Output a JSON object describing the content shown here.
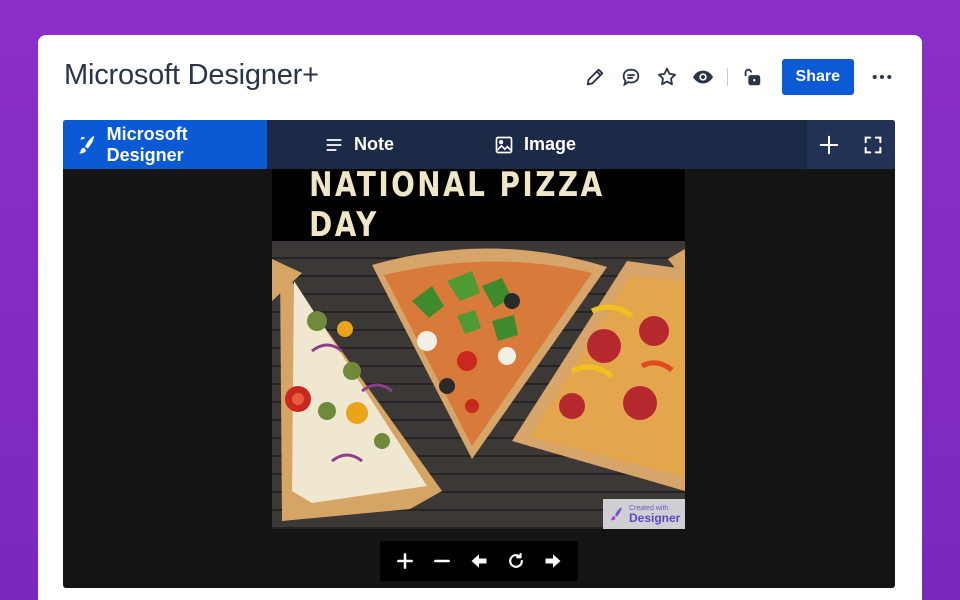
{
  "page": {
    "title": "Microsoft Designer+"
  },
  "top_actions": {
    "icons": [
      "pencil-icon",
      "comment-icon",
      "star-icon",
      "eye-icon",
      "unlock-icon",
      "more-icon"
    ],
    "share_label": "Share"
  },
  "embed": {
    "brand_label": "Microsoft Designer",
    "tabs": [
      {
        "label": "Note",
        "icon": "note-lines-icon"
      },
      {
        "label": "Image",
        "icon": "image-icon"
      }
    ],
    "right_icons": [
      "plus-icon",
      "fullscreen-icon"
    ],
    "poster": {
      "title": "NATIONAL PIZZA DAY",
      "watermark_small": "Created with",
      "watermark_big": "Designer"
    },
    "controls": [
      "zoom-in-icon",
      "zoom-out-icon",
      "arrow-left-icon",
      "reset-icon",
      "arrow-right-icon"
    ]
  },
  "colors": {
    "accent": "#0c5ad6",
    "bar": "#1b2b47",
    "background": "#8a2fc7"
  }
}
